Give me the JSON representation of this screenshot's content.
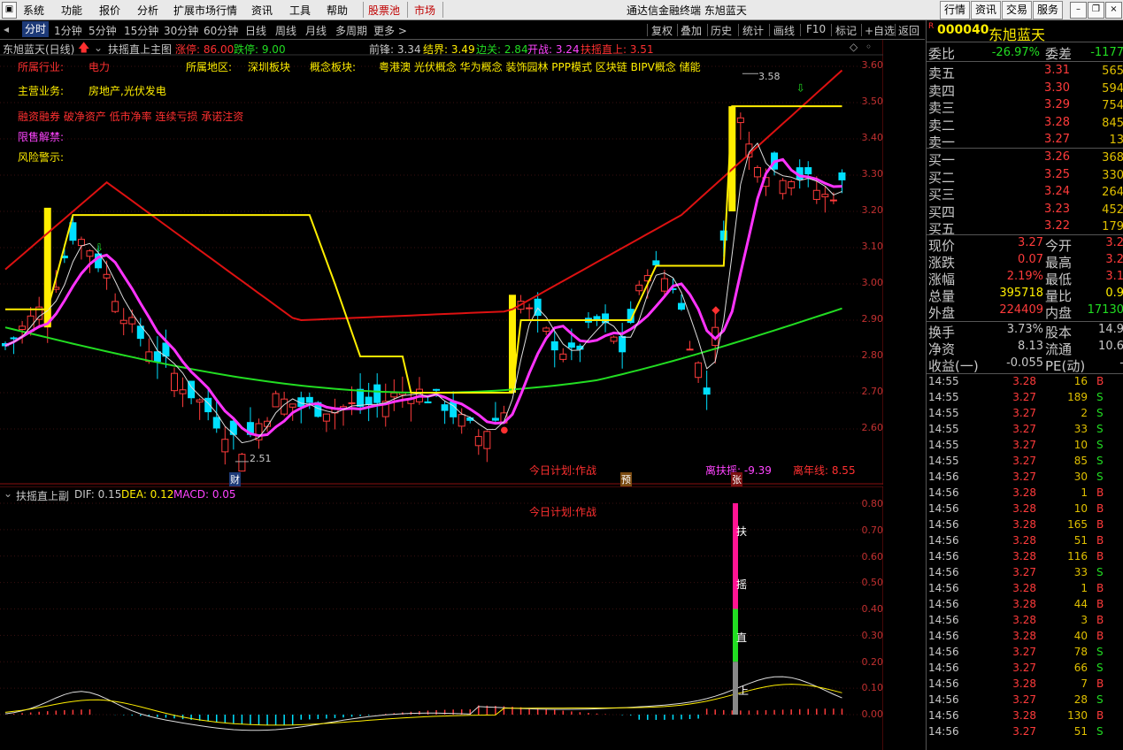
{
  "menubar": {
    "items": [
      "系统",
      "功能",
      "报价",
      "分析",
      "扩展市场行情",
      "资讯",
      "工具",
      "帮助"
    ],
    "stock_pool": "股票池",
    "market": "市场",
    "title": "通达信金融终端  东旭蓝天",
    "right_buttons": [
      "行情",
      "资讯",
      "交易",
      "服务"
    ]
  },
  "toolbar": {
    "periods": [
      "分时",
      "1分钟",
      "5分钟",
      "15分钟",
      "30分钟",
      "60分钟",
      "日线",
      "周线",
      "月线",
      "多周期",
      "更多 >"
    ],
    "right": [
      "复权",
      "叠加",
      "历史",
      "统计",
      "画线",
      "F10",
      "标记",
      "+自选",
      "返回"
    ]
  },
  "main_header": {
    "stock": "东旭蓝天(日线)",
    "formula": "扶摇直上主图",
    "limit_up": "涨停: 86.00",
    "limit_down": "跌停: 9.00",
    "qianfeng": "前锋: 3.34",
    "jiejie": "结界: 3.49",
    "bianguan": "边关: 2.84",
    "kaizhan": "开战: 3.24",
    "fuyao": "扶摇直上: 3.51"
  },
  "info": {
    "industry_label": "所属行业:",
    "industry": "电力",
    "region_label": "所属地区:",
    "region": "深圳板块",
    "concept_label": "概念板块:",
    "concept": "粤港澳 光伏概念 华为概念 装饰园林 PPP模式 区块链 BIPV概念 储能",
    "business_label": "主营业务:",
    "business": "房地产,光伏发电",
    "tags": "融资融券 破净资产 低市净率 连续亏损 承诺注资",
    "unlock_label": "限售解禁:",
    "risk_label": "风险警示:"
  },
  "annotations": {
    "today_plan": "今日计划:作战",
    "li_fuyao": "离扶摇: -9.39",
    "li_nianxian": "离年线: 8.55",
    "high_label": "3.58",
    "low_label": "2.51",
    "cai": "财",
    "yu": "预",
    "zhang": "张"
  },
  "sub_header": {
    "formula": "扶摇直上副",
    "dif": "DIF: 0.15",
    "dea": "DEA: 0.12",
    "macd": "MACD: 0.05",
    "today_plan": "今日计划:作战",
    "signal_chars": [
      "扶",
      "摇",
      "直",
      "上"
    ]
  },
  "main_axis": [
    "3.60",
    "3.50",
    "3.40",
    "3.30",
    "3.20",
    "3.10",
    "3.00",
    "2.90",
    "2.80",
    "2.70",
    "2.60"
  ],
  "sub_axis": [
    "0.80",
    "0.70",
    "0.60",
    "0.50",
    "0.40",
    "0.30",
    "0.20",
    "0.10",
    "0.00"
  ],
  "quote": {
    "code": "000040",
    "name": "东旭蓝天",
    "weibi_label": "委比",
    "weibi": "-26.97%",
    "weicha_label": "委差",
    "weicha": "-1177",
    "asks": [
      {
        "label": "卖五",
        "price": "3.31",
        "vol": "565"
      },
      {
        "label": "卖四",
        "price": "3.30",
        "vol": "594"
      },
      {
        "label": "卖三",
        "price": "3.29",
        "vol": "754"
      },
      {
        "label": "卖二",
        "price": "3.28",
        "vol": "845"
      },
      {
        "label": "卖一",
        "price": "3.27",
        "vol": "13"
      }
    ],
    "bids": [
      {
        "label": "买一",
        "price": "3.26",
        "vol": "368"
      },
      {
        "label": "买二",
        "price": "3.25",
        "vol": "330"
      },
      {
        "label": "买三",
        "price": "3.24",
        "vol": "264"
      },
      {
        "label": "买四",
        "price": "3.23",
        "vol": "452"
      },
      {
        "label": "买五",
        "price": "3.22",
        "vol": "179"
      }
    ],
    "stats": [
      {
        "l1": "现价",
        "v1": "3.27",
        "l2": "今开",
        "v2": "3.2"
      },
      {
        "l1": "涨跌",
        "v1": "0.07",
        "l2": "最高",
        "v2": "3.2"
      },
      {
        "l1": "涨幅",
        "v1": "2.19%",
        "l2": "最低",
        "v2": "3.1"
      },
      {
        "l1": "总量",
        "v1": "395718",
        "l2": "量比",
        "v2": "0.9"
      },
      {
        "l1": "外盘",
        "v1": "224409",
        "l2": "内盘",
        "v2": "17130"
      }
    ],
    "stats2": [
      {
        "l1": "换手",
        "v1": "3.73%",
        "l2": "股本",
        "v2": "14.9"
      },
      {
        "l1": "净资",
        "v1": "8.13",
        "l2": "流通",
        "v2": "10.6"
      },
      {
        "l1": "收益(一)",
        "v1": "-0.055",
        "l2": "PE(动)",
        "v2": "-"
      }
    ]
  },
  "ticks": [
    {
      "t": "14:55",
      "p": "3.28",
      "v": "16",
      "s": "B"
    },
    {
      "t": "14:55",
      "p": "3.27",
      "v": "189",
      "s": "S"
    },
    {
      "t": "14:55",
      "p": "3.27",
      "v": "2",
      "s": "S"
    },
    {
      "t": "14:55",
      "p": "3.27",
      "v": "33",
      "s": "S"
    },
    {
      "t": "14:55",
      "p": "3.27",
      "v": "10",
      "s": "S"
    },
    {
      "t": "14:55",
      "p": "3.27",
      "v": "85",
      "s": "S"
    },
    {
      "t": "14:56",
      "p": "3.27",
      "v": "30",
      "s": "S"
    },
    {
      "t": "14:56",
      "p": "3.28",
      "v": "1",
      "s": "B"
    },
    {
      "t": "14:56",
      "p": "3.28",
      "v": "10",
      "s": "B"
    },
    {
      "t": "14:56",
      "p": "3.28",
      "v": "165",
      "s": "B"
    },
    {
      "t": "14:56",
      "p": "3.28",
      "v": "51",
      "s": "B"
    },
    {
      "t": "14:56",
      "p": "3.28",
      "v": "116",
      "s": "B"
    },
    {
      "t": "14:56",
      "p": "3.27",
      "v": "33",
      "s": "S"
    },
    {
      "t": "14:56",
      "p": "3.28",
      "v": "1",
      "s": "B"
    },
    {
      "t": "14:56",
      "p": "3.28",
      "v": "44",
      "s": "B"
    },
    {
      "t": "14:56",
      "p": "3.28",
      "v": "3",
      "s": "B"
    },
    {
      "t": "14:56",
      "p": "3.28",
      "v": "40",
      "s": "B"
    },
    {
      "t": "14:56",
      "p": "3.27",
      "v": "78",
      "s": "S"
    },
    {
      "t": "14:56",
      "p": "3.27",
      "v": "66",
      "s": "S"
    },
    {
      "t": "14:56",
      "p": "3.28",
      "v": "7",
      "s": "B"
    },
    {
      "t": "14:56",
      "p": "3.27",
      "v": "28",
      "s": "S"
    },
    {
      "t": "14:56",
      "p": "3.28",
      "v": "130",
      "s": "B"
    },
    {
      "t": "14:56",
      "p": "3.27",
      "v": "51",
      "s": "S"
    }
  ],
  "colors": {
    "up": "#ff3b3b",
    "down": "#00e0ff",
    "yellow": "#ffee00",
    "magenta": "#ff33ff",
    "green": "#22dd22",
    "red_line": "#dd1111"
  }
}
